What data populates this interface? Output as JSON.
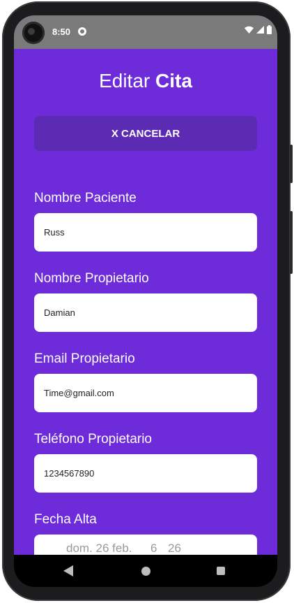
{
  "status_bar": {
    "time": "8:50"
  },
  "title": {
    "prefix": "Editar ",
    "bold": "Cita"
  },
  "cancel_button": {
    "label": "X CANCELAR"
  },
  "form": {
    "patient_name": {
      "label": "Nombre Paciente",
      "value": "Russ"
    },
    "owner_name": {
      "label": "Nombre Propietario",
      "value": "Damian"
    },
    "owner_email": {
      "label": "Email Propietario",
      "value": "Time@gmail.com"
    },
    "owner_phone": {
      "label": "Teléfono Propietario",
      "value": "1234567890"
    },
    "date": {
      "label": "Fecha Alta",
      "day": "dom. 26 feb.",
      "hour": "6",
      "minute": "26"
    }
  },
  "colors": {
    "accent": "#6d2bd9",
    "button": "#5c2bb3"
  }
}
